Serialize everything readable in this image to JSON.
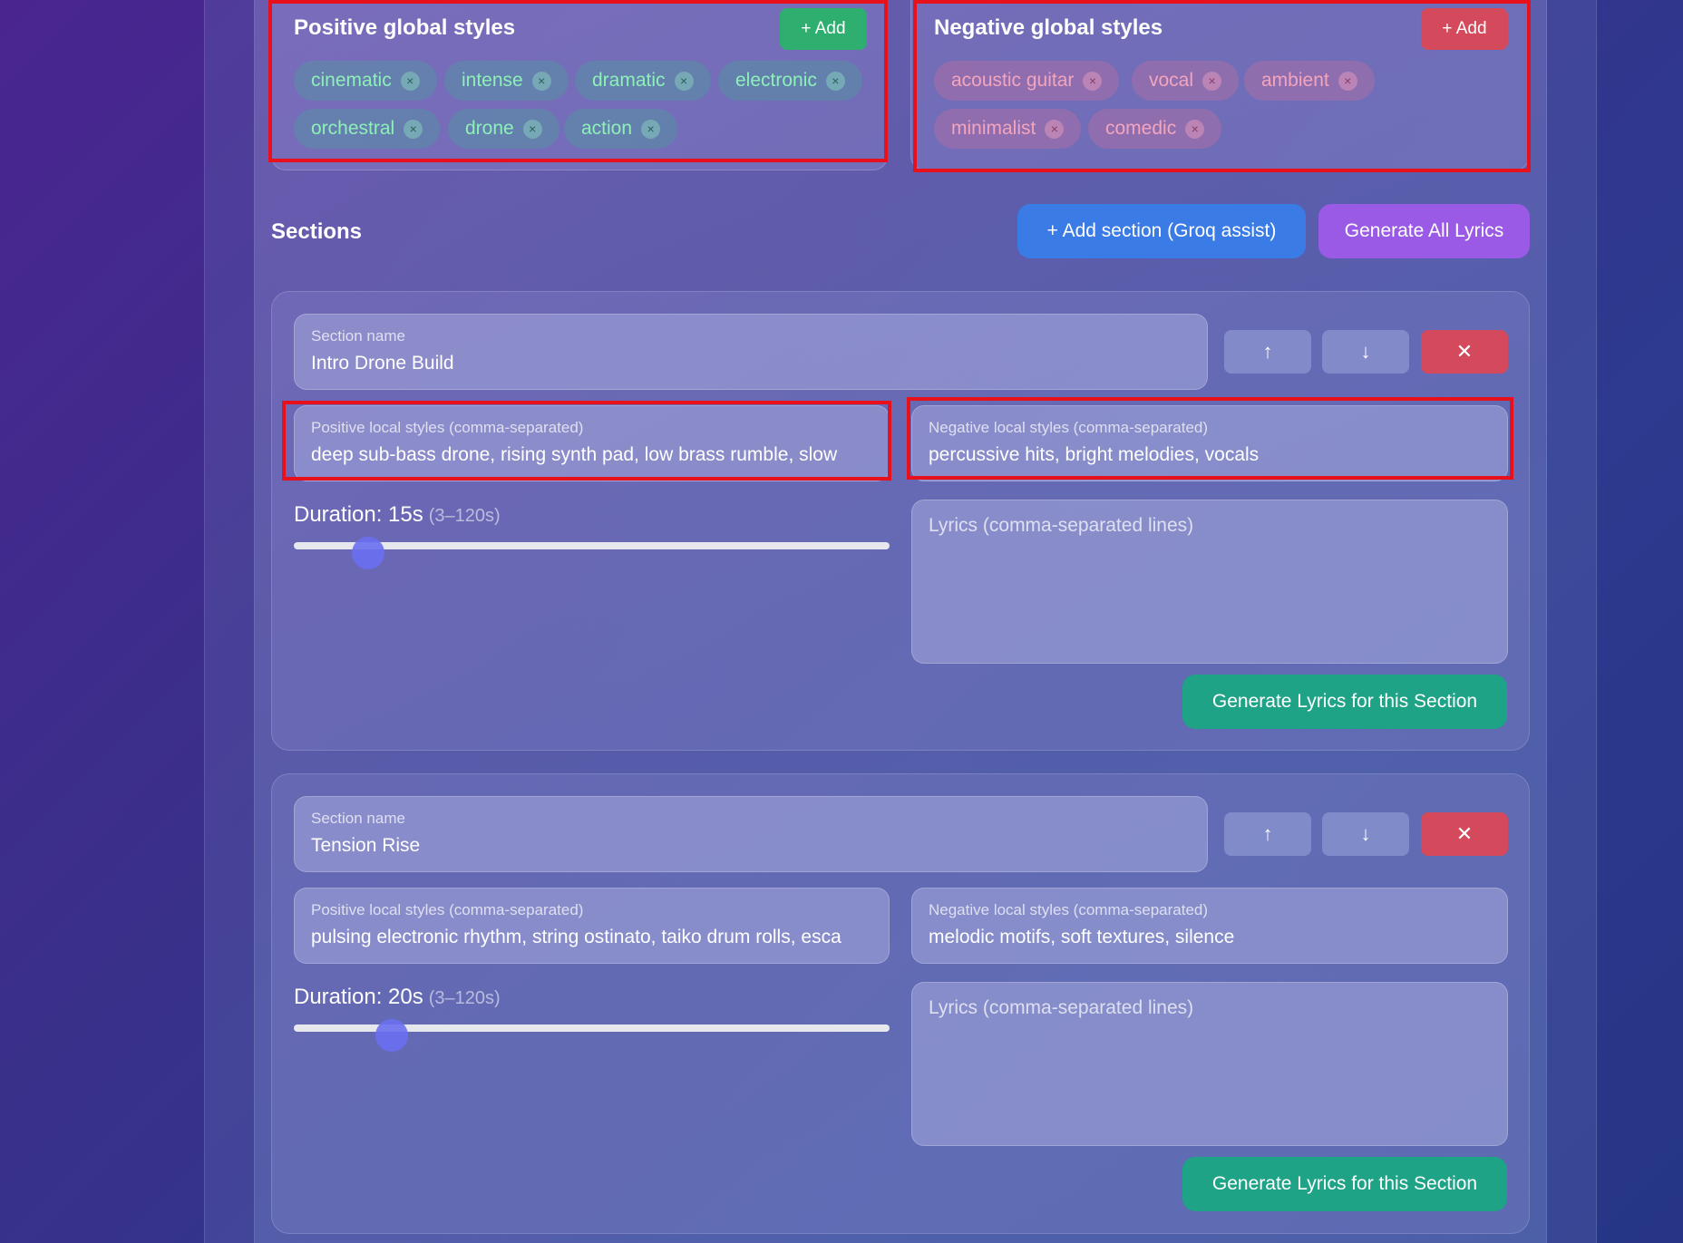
{
  "positive_global": {
    "title": "Positive global styles",
    "add_label": "+ Add",
    "chips": [
      "cinematic",
      "intense",
      "dramatic",
      "electronic",
      "orchestral",
      "drone",
      "action"
    ]
  },
  "negative_global": {
    "title": "Negative global styles",
    "add_label": "+ Add",
    "chips": [
      "acoustic guitar",
      "vocal",
      "ambient",
      "minimalist",
      "comedic"
    ]
  },
  "chip_remove_glyph": "×",
  "sections_header": {
    "title": "Sections",
    "add_section_label": "+ Add section (Groq assist)",
    "generate_all_label": "Generate All Lyrics"
  },
  "sections": [
    {
      "name_label": "Section name",
      "name": "Intro Drone Build",
      "pos_label": "Positive local styles (comma-separated)",
      "pos_value": "deep sub-bass drone, rising synth pad, low brass rumble, slow",
      "neg_label": "Negative local styles (comma-separated)",
      "neg_value": "percussive hits, bright melodies, vocals",
      "duration_label": "Duration: 15s",
      "duration_range": "(3–120s)",
      "duration_seconds": 15,
      "lyrics_placeholder": "Lyrics (comma-separated lines)",
      "generate_label": "Generate Lyrics for this Section"
    },
    {
      "name_label": "Section name",
      "name": "Tension Rise",
      "pos_label": "Positive local styles (comma-separated)",
      "pos_value": "pulsing electronic rhythm, string ostinato, taiko drum rolls, esca",
      "neg_label": "Negative local styles (comma-separated)",
      "neg_value": "melodic motifs, soft textures, silence",
      "duration_label": "Duration: 20s",
      "duration_range": "(3–120s)",
      "duration_seconds": 20,
      "lyrics_placeholder": "Lyrics (comma-separated lines)",
      "generate_label": "Generate Lyrics for this Section"
    }
  ],
  "icons": {
    "up": "↑",
    "down": "↓",
    "delete": "✕"
  },
  "colors": {
    "add_green": "#2eae6f",
    "add_red": "#d44a5c",
    "blue_button": "#3a7be6",
    "purple_button": "#9a5ae6",
    "generate_button": "#1fa386",
    "highlight_box": "#e8101a"
  }
}
